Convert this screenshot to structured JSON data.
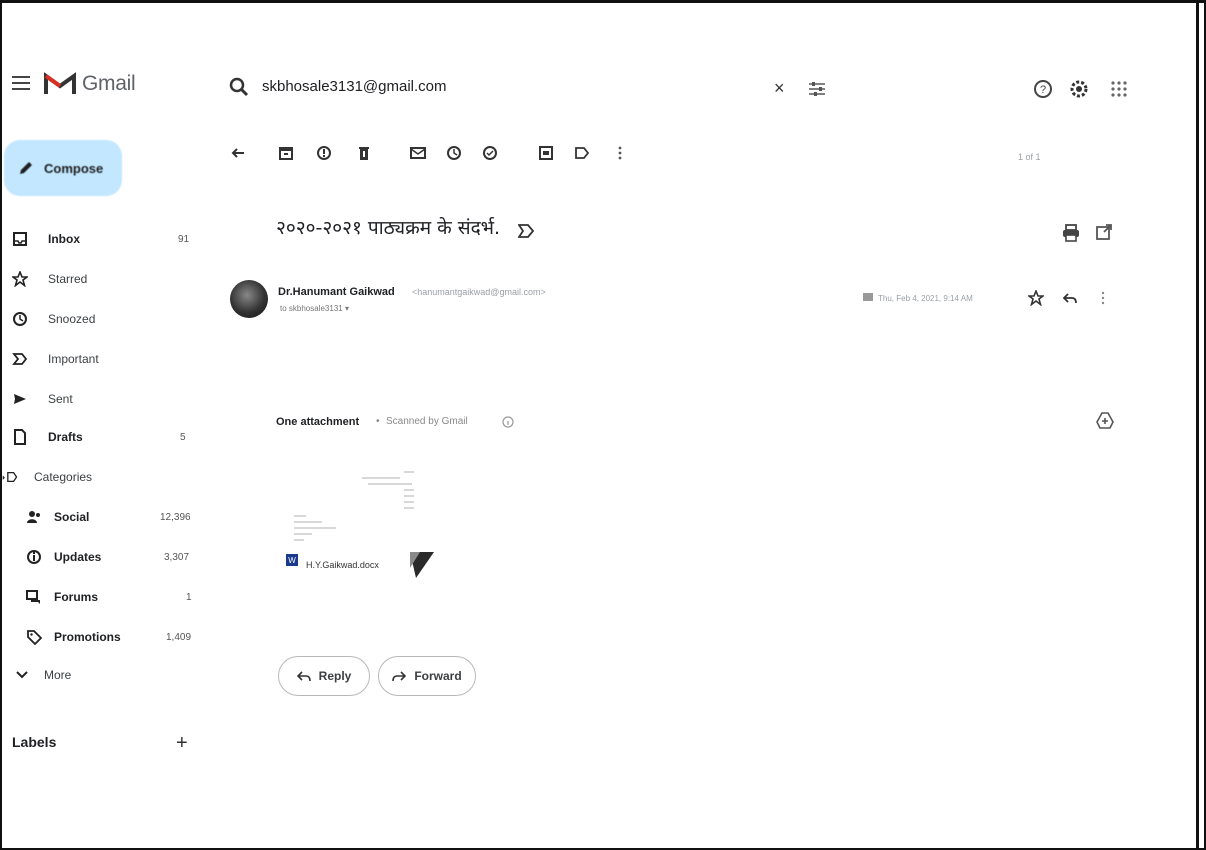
{
  "app": {
    "logo_text": "Gmail"
  },
  "search": {
    "query": "skbhosale3131@gmail.com",
    "clear": "×"
  },
  "compose": {
    "label": "Compose"
  },
  "sidebar": {
    "items": [
      {
        "label": "Inbox",
        "count": "91",
        "icon": "inbox-icon"
      },
      {
        "label": "Starred",
        "count": "",
        "icon": "star-icon"
      },
      {
        "label": "Snoozed",
        "count": "",
        "icon": "clock-icon"
      },
      {
        "label": "Important",
        "count": "",
        "icon": "important-icon"
      },
      {
        "label": "Sent",
        "count": "",
        "icon": "send-icon"
      },
      {
        "label": "Drafts",
        "count": "5",
        "icon": "draft-icon"
      },
      {
        "label": "Categories",
        "count": "",
        "icon": "label-icon"
      },
      {
        "label": "Social",
        "count": "12,396",
        "icon": "people-icon"
      },
      {
        "label": "Updates",
        "count": "3,307",
        "icon": "info-icon"
      },
      {
        "label": "Forums",
        "count": "1",
        "icon": "forum-icon"
      },
      {
        "label": "Promotions",
        "count": "1,409",
        "icon": "tag-icon"
      },
      {
        "label": "More",
        "count": "",
        "icon": "chevron-down-icon"
      }
    ],
    "labels_title": "Labels",
    "labels_add": "+"
  },
  "toolbar": {
    "pager": "1 of 1"
  },
  "message": {
    "subject": "२०२०-२०२१ पाठ्यक्रम के संदर्भ.",
    "sender_name": "Dr.Hanumant Gaikwad",
    "sender_email": "<hanumantgaikwad@gmail.com>",
    "to_line": "to skbhosale3131 ▾",
    "date": "Thu, Feb 4, 2021, 9:14 AM"
  },
  "attachment": {
    "title": "One attachment",
    "separator": "•",
    "scanned": "Scanned by Gmail",
    "file_name": "H.Y.Gaikwad.docx"
  },
  "actions": {
    "reply": "Reply",
    "forward": "Forward"
  },
  "colors": {
    "compose_bg": "#c2e7ff",
    "gmail_red": "#d93025",
    "doc_blue": "#1a3a8f"
  }
}
